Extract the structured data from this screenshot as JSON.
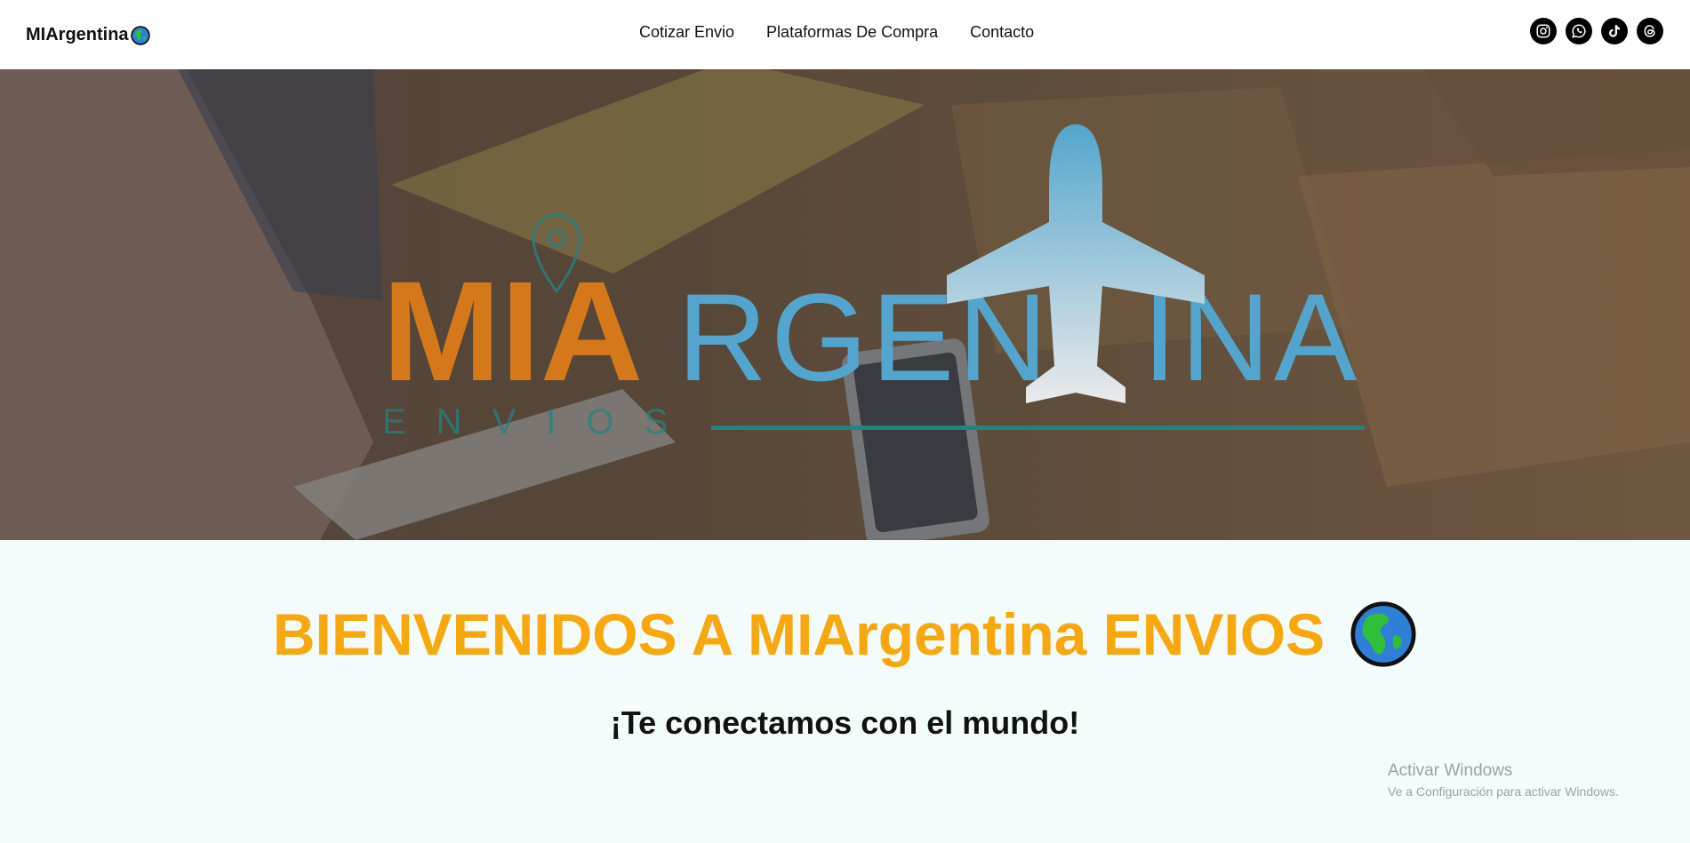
{
  "header": {
    "brand": "MIArgentina",
    "nav": [
      {
        "label": "Cotizar Envio"
      },
      {
        "label": "Plataformas De Compra"
      },
      {
        "label": "Contacto"
      }
    ],
    "social": [
      "instagram-icon",
      "whatsapp-icon",
      "tiktok-icon",
      "threads-icon"
    ]
  },
  "hero": {
    "logo_mia": "MIA",
    "logo_rgen": "RGEN",
    "logo_ina": "INA",
    "logo_envios": "ENVIOS"
  },
  "welcome": {
    "title": "BIENVENIDOS A MIArgentina ENVIOS",
    "subtitle": "¡Te conectamos con el mundo!"
  },
  "watermark": {
    "line1": "Activar Windows",
    "line2": "Ve a Configuración para activar Windows."
  },
  "colors": {
    "accent": "#f8a80d",
    "logo_orange": "#e8831f",
    "logo_blue": "#5bb4df"
  }
}
